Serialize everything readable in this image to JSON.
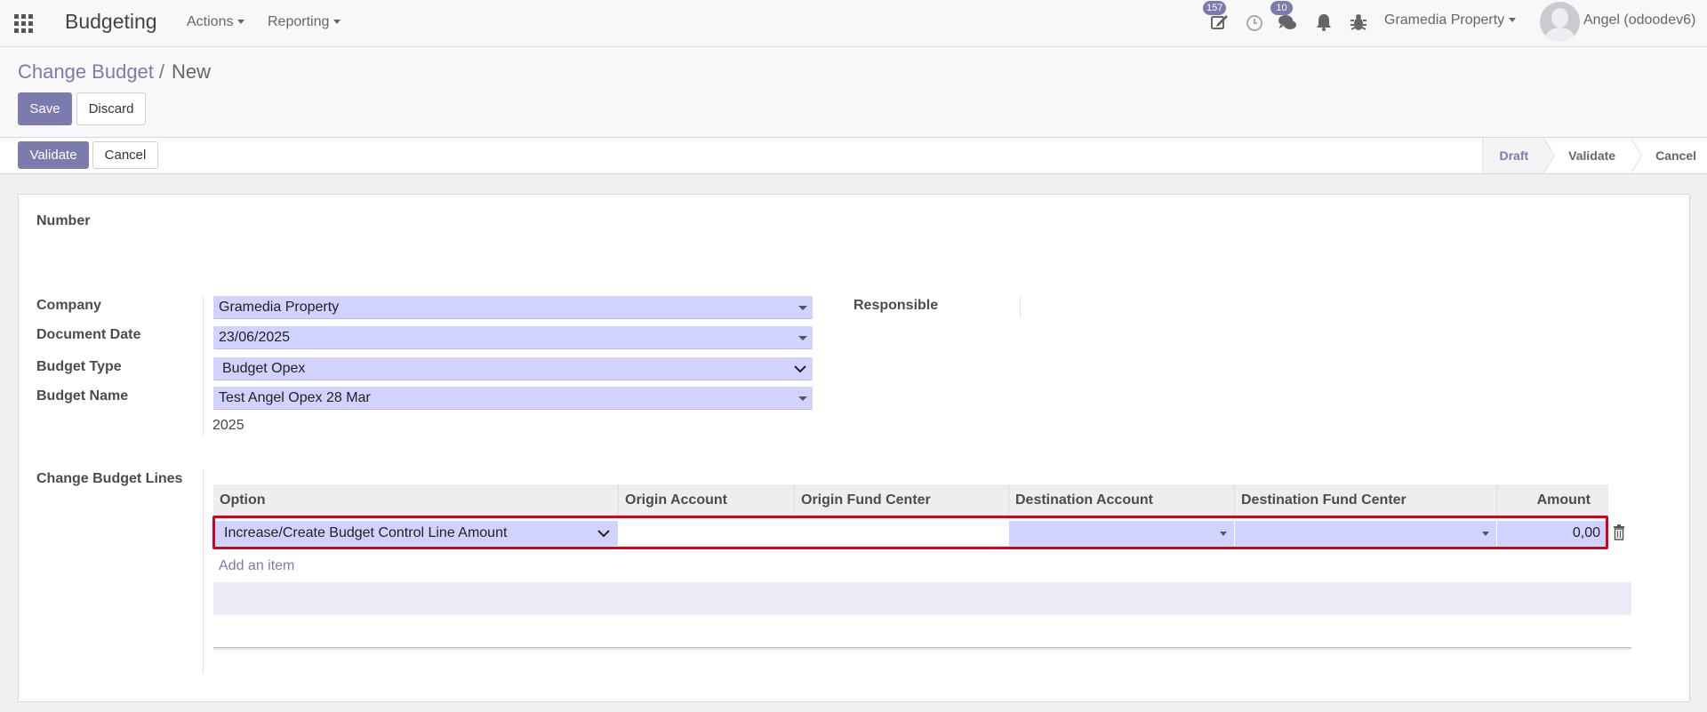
{
  "navbar": {
    "app_name": "Budgeting",
    "menus": [
      "Actions",
      "Reporting"
    ],
    "activity_badge": "157",
    "messages_badge": "10",
    "company": "Gramedia Property",
    "user": "Angel (odoodev6)"
  },
  "control_panel": {
    "breadcrumb_parent": "Change Budget",
    "breadcrumb_current": "New",
    "save_label": "Save",
    "discard_label": "Discard"
  },
  "statusbar": {
    "validate_label": "Validate",
    "cancel_label": "Cancel",
    "stages": [
      "Draft",
      "Validate",
      "Cancel"
    ],
    "active_stage": "Draft"
  },
  "form": {
    "number_label": "Number",
    "company_label": "Company",
    "company_value": "Gramedia Property",
    "document_date_label": "Document Date",
    "document_date_value": "23/06/2025",
    "budget_type_label": "Budget Type",
    "budget_type_value": "Budget Opex",
    "budget_name_label": "Budget Name",
    "budget_name_value": "Test Angel Opex 28 Mar",
    "budget_year": "2025",
    "responsible_label": "Responsible",
    "lines_label": "Change Budget Lines"
  },
  "lines_table": {
    "columns": [
      "Option",
      "Origin Account",
      "Origin Fund Center",
      "Destination Account",
      "Destination Fund Center",
      "Amount"
    ],
    "rows": [
      {
        "option": "Increase/Create Budget Control Line Amount",
        "origin_account": "",
        "origin_fund_center": "",
        "destination_account": "",
        "destination_fund_center": "",
        "amount": "0,00"
      }
    ],
    "add_item_label": "Add an item"
  },
  "colors": {
    "accent": "#7c7bad",
    "field_bg": "#d2d2ff",
    "highlight": "#d9001b"
  }
}
